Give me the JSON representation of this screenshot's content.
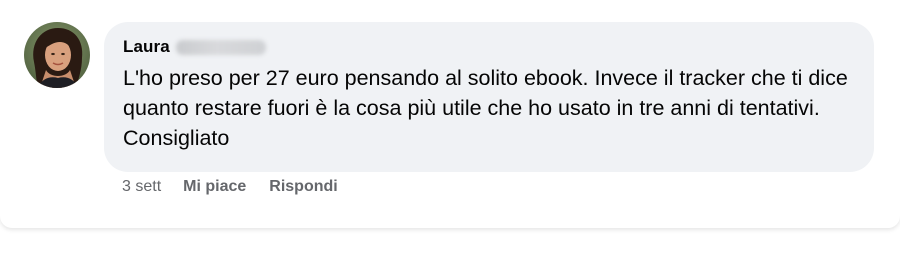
{
  "comment": {
    "author": "Laura",
    "text": "L'ho preso per 27 euro pensando al solito ebook. Invece il tracker che ti dice quanto restare fuori è la cosa più utile che ho usato in tre anni di tentativi. Consigliato",
    "time": "3 sett",
    "like_label": "Mi piace",
    "reply_label": "Rispondi"
  },
  "colors": {
    "bubble_bg": "#f0f2f5",
    "text": "#050505",
    "meta_text": "#65676b"
  }
}
